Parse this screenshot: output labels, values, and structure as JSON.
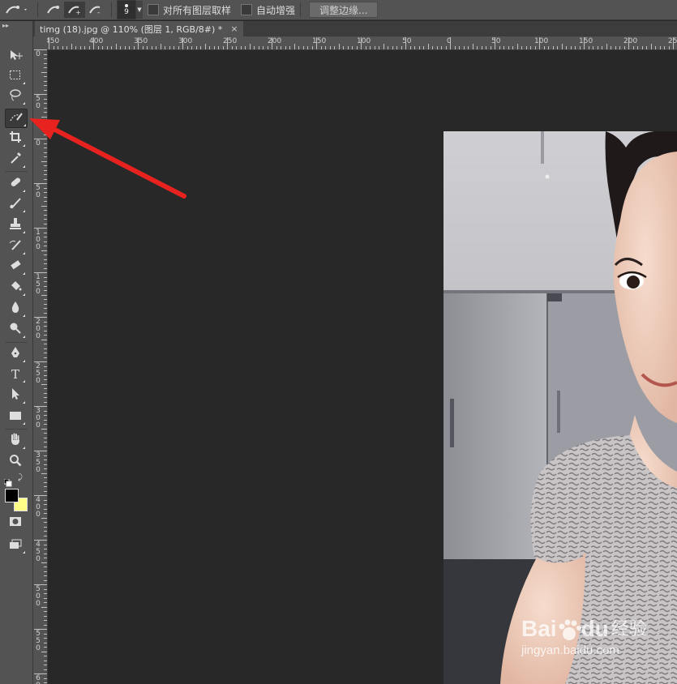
{
  "options_bar": {
    "brush_size": "9",
    "sample_all_layers_label": "对所有图层取样",
    "auto_enhance_label": "自动增强",
    "refine_edge_label": "调整边缘..."
  },
  "tools": [
    {
      "name": "move-tool",
      "icon": "move-icon"
    },
    {
      "name": "marquee-tool",
      "icon": "rect-marquee-icon"
    },
    {
      "name": "lasso-tool",
      "icon": "lasso-icon"
    },
    {
      "name": "quick-selection-tool",
      "icon": "quick-selection-icon",
      "active": true
    },
    {
      "name": "crop-tool",
      "icon": "crop-icon"
    },
    {
      "name": "eyedropper-tool",
      "icon": "eyedropper-icon"
    },
    {
      "name": "healing-brush-tool",
      "icon": "bandage-icon"
    },
    {
      "name": "brush-tool",
      "icon": "brush-icon"
    },
    {
      "name": "clone-stamp-tool",
      "icon": "stamp-icon"
    },
    {
      "name": "history-brush-tool",
      "icon": "history-brush-icon"
    },
    {
      "name": "eraser-tool",
      "icon": "eraser-icon"
    },
    {
      "name": "paint-bucket-tool",
      "icon": "bucket-icon"
    },
    {
      "name": "blur-tool",
      "icon": "drop-icon"
    },
    {
      "name": "dodge-tool",
      "icon": "dodge-icon"
    },
    {
      "name": "pen-tool",
      "icon": "pen-icon"
    },
    {
      "name": "type-tool",
      "icon": "type-icon",
      "glyph": "T"
    },
    {
      "name": "path-selection-tool",
      "icon": "arrow-select-icon"
    },
    {
      "name": "rectangle-tool",
      "icon": "rectangle-icon"
    },
    {
      "name": "hand-tool",
      "icon": "hand-icon"
    },
    {
      "name": "zoom-tool",
      "icon": "zoom-icon"
    }
  ],
  "colors": {
    "foreground": "#000000",
    "background": "#ffff88",
    "arrow": "#e8231f"
  },
  "document": {
    "tab_title": "timg (18).jpg @ 110% (图层 1, RGB/8#) *",
    "close_glyph": "×"
  },
  "ruler": {
    "h_labels": [
      "450",
      "400",
      "350",
      "300",
      "250",
      "200",
      "150",
      "100",
      "50",
      "0",
      "50",
      "100",
      "150",
      "200",
      "250"
    ],
    "v_labels": [
      "0",
      "50",
      "0",
      "50",
      "100",
      "150",
      "200",
      "250",
      "300",
      "350",
      "400",
      "450",
      "500",
      "550",
      "600"
    ]
  },
  "watermark": {
    "brand": "Bai",
    "brand2": "du",
    "suffix": "经验",
    "url": "jingyan.baidu.com"
  }
}
